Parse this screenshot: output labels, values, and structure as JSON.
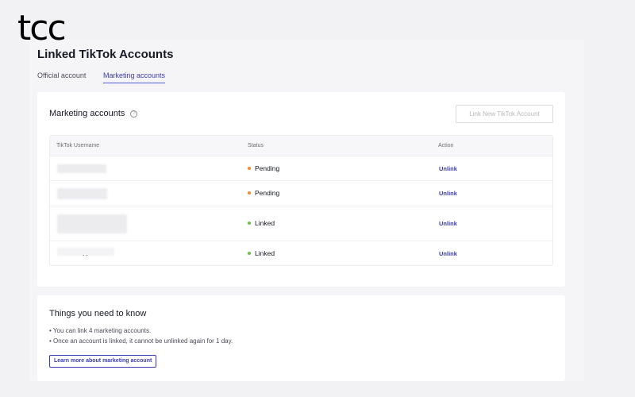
{
  "brand": {
    "logo_text": "tcc"
  },
  "page": {
    "title": "Linked TikTok Accounts"
  },
  "tabs": [
    {
      "label": "Official account",
      "active": false
    },
    {
      "label": "Marketing accounts",
      "active": true
    }
  ],
  "marketing_card": {
    "title": "Marketing accounts",
    "help_icon": "question-circle-icon",
    "link_button_label": "Link New TikTok Account",
    "columns": [
      "TikTok Username",
      "Status",
      "Action"
    ],
    "rows": [
      {
        "username": "",
        "status": "Pending",
        "status_color": "#f08a3c",
        "action": "Unlink"
      },
      {
        "username": "",
        "status": "Pending",
        "status_color": "#f08a3c",
        "action": "Unlink"
      },
      {
        "username": "",
        "status": "Linked",
        "status_color": "#6cc24a",
        "action": "Unlink"
      },
      {
        "username": ". .",
        "status": "Linked",
        "status_color": "#6cc24a",
        "action": "Unlink"
      }
    ]
  },
  "info_card": {
    "title": "Things you need to know",
    "bullets": [
      "You can link 4 marketing accounts.",
      "Once an account is linked, it cannot be unlinked again for 1 day."
    ],
    "learn_more_label": "Learn more about marketing account"
  },
  "colors": {
    "accent": "#3b3bb3",
    "pending": "#f08a3c",
    "linked": "#6cc24a"
  }
}
